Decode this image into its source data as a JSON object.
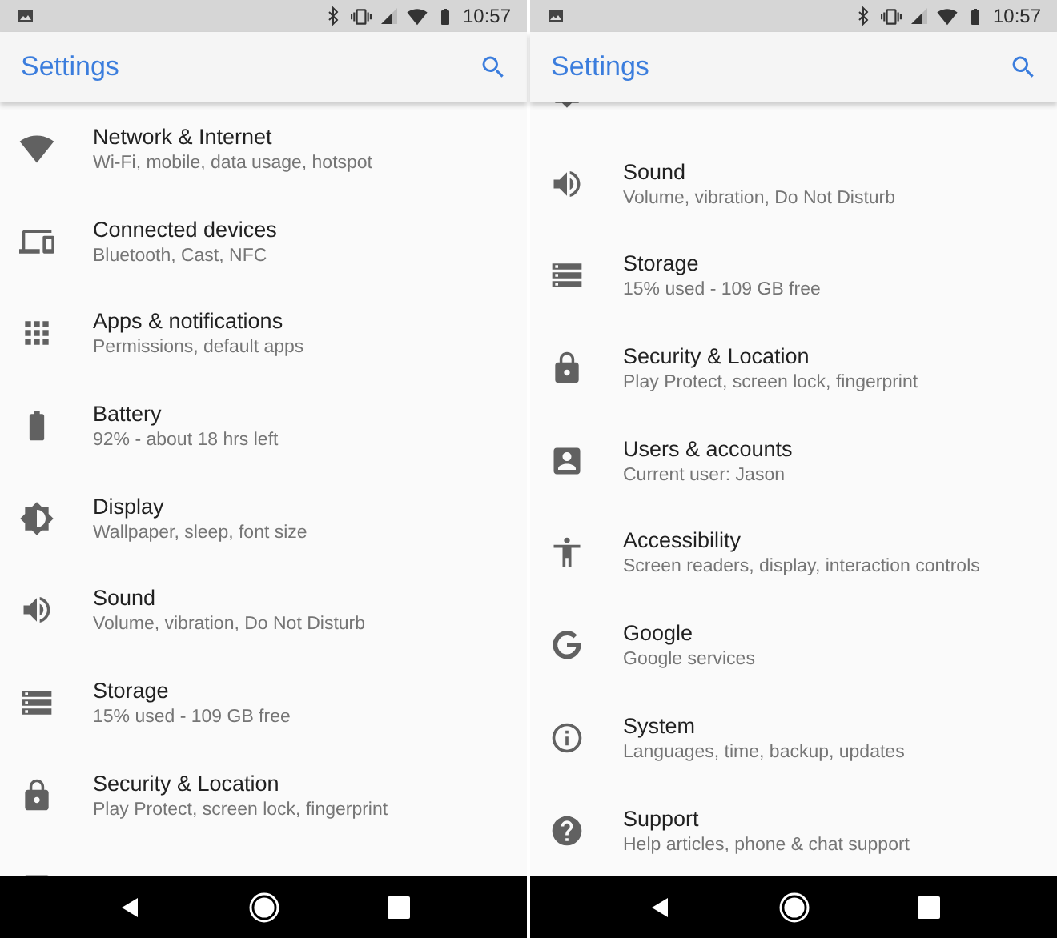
{
  "panels": [
    {
      "status_bar": {
        "time": "10:57"
      },
      "app_bar": {
        "title": "Settings"
      },
      "scrolled": false,
      "items": [
        {
          "kind": "network",
          "title": "Network & Internet",
          "subtitle": "Wi-Fi, mobile, data usage, hotspot"
        },
        {
          "kind": "devices",
          "title": "Connected devices",
          "subtitle": "Bluetooth, Cast, NFC"
        },
        {
          "kind": "apps",
          "title": "Apps & notifications",
          "subtitle": "Permissions, default apps"
        },
        {
          "kind": "battery",
          "title": "Battery",
          "subtitle": "92% - about 18 hrs left"
        },
        {
          "kind": "display",
          "title": "Display",
          "subtitle": "Wallpaper, sleep, font size"
        },
        {
          "kind": "sound",
          "title": "Sound",
          "subtitle": "Volume, vibration, Do Not Disturb"
        },
        {
          "kind": "storage",
          "title": "Storage",
          "subtitle": "15% used - 109 GB free"
        },
        {
          "kind": "security",
          "title": "Security & Location",
          "subtitle": "Play Protect, screen lock, fingerprint"
        },
        {
          "kind": "users"
        }
      ]
    },
    {
      "status_bar": {
        "time": "10:57"
      },
      "app_bar": {
        "title": "Settings"
      },
      "scrolled": true,
      "items": [
        {
          "kind": "display"
        },
        {
          "kind": "sound",
          "title": "Sound",
          "subtitle": "Volume, vibration, Do Not Disturb"
        },
        {
          "kind": "storage",
          "title": "Storage",
          "subtitle": "15% used - 109 GB free"
        },
        {
          "kind": "security",
          "title": "Security & Location",
          "subtitle": "Play Protect, screen lock, fingerprint"
        },
        {
          "kind": "users",
          "title": "Users & accounts",
          "subtitle": "Current user: Jason"
        },
        {
          "kind": "accessibility",
          "title": "Accessibility",
          "subtitle": "Screen readers, display, interaction controls"
        },
        {
          "kind": "google",
          "title": "Google",
          "subtitle": "Google services"
        },
        {
          "kind": "system",
          "title": "System",
          "subtitle": "Languages, time, backup, updates"
        },
        {
          "kind": "support",
          "title": "Support",
          "subtitle": "Help articles, phone & chat support"
        }
      ]
    }
  ]
}
